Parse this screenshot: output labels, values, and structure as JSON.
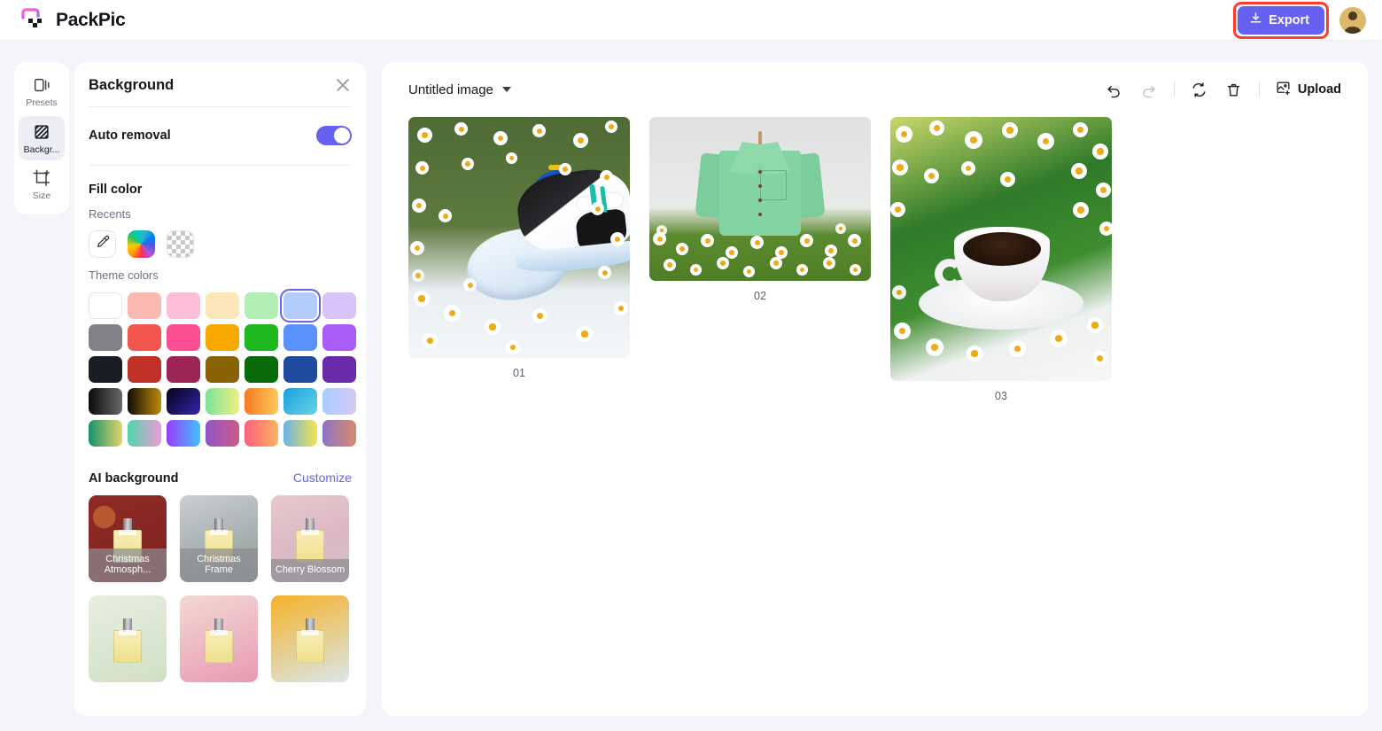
{
  "app": {
    "name": "PackPic",
    "logo_icon": "packpic-logo-icon"
  },
  "topbar": {
    "export_label": "Export",
    "export_icon": "download-icon",
    "export_color": "#6761f2",
    "highlight_color": "#ff3b30",
    "avatar_icon": "user-avatar-icon"
  },
  "rail": {
    "items": [
      {
        "label": "Presets",
        "icon": "presets-icon",
        "active": false
      },
      {
        "label": "Backgr...",
        "icon": "background-icon",
        "active": true
      },
      {
        "label": "Size",
        "icon": "size-crop-icon",
        "active": false
      }
    ]
  },
  "panel": {
    "title": "Background",
    "close_icon": "close-icon",
    "auto_removal": {
      "label": "Auto removal",
      "enabled": true,
      "accent": "#6761f2"
    },
    "fill_color": {
      "title": "Fill color",
      "recents_label": "Recents",
      "recents": [
        {
          "name": "eyedropper-swatch",
          "icon": "eyedropper-icon",
          "type": "eyedropper"
        },
        {
          "name": "rainbow-picker-swatch",
          "type": "rainbow"
        },
        {
          "name": "transparent-swatch",
          "type": "transparent"
        }
      ],
      "theme_label": "Theme colors",
      "selected_index": 5,
      "theme_colors": [
        {
          "color": "#ffffff",
          "bordered": true
        },
        {
          "color": "#fcb9b2"
        },
        {
          "color": "#fcbdd6"
        },
        {
          "color": "#fbe6b9"
        },
        {
          "color": "#b3eeb4"
        },
        {
          "color": "#b4ccfb"
        },
        {
          "color": "#d9c4fa"
        },
        {
          "color": "#808287"
        },
        {
          "color": "#f0564e"
        },
        {
          "color": "#fb4d92"
        },
        {
          "color": "#f9a800"
        },
        {
          "color": "#1eb81e"
        },
        {
          "color": "#5b91fb"
        },
        {
          "color": "#a95cf6"
        },
        {
          "color": "#1b1d24"
        },
        {
          "color": "#bf3029"
        },
        {
          "color": "#9c2457"
        },
        {
          "color": "#8a6206"
        },
        {
          "color": "#0a6b0a"
        },
        {
          "color": "#1f4a9e"
        },
        {
          "color": "#6a2aa9"
        },
        {
          "color": "linear-gradient(90deg,#0a0a0a,#6a6a6a)"
        },
        {
          "color": "linear-gradient(90deg,#100d05,#c08a0a)"
        },
        {
          "color": "linear-gradient(135deg,#050318,#3525ad)"
        },
        {
          "color": "linear-gradient(90deg,#79e39a,#f0ef80)"
        },
        {
          "color": "linear-gradient(90deg,#f87a22,#fbc85a)"
        },
        {
          "color": "linear-gradient(135deg,#1a9fe0,#68d2e8)"
        },
        {
          "color": "linear-gradient(90deg,#a9cdfb,#d6c9f7)"
        },
        {
          "color": "linear-gradient(90deg,#16916e,#e3d46a)"
        },
        {
          "color": "linear-gradient(90deg,#4fd6ad,#ef9bd4)"
        },
        {
          "color": "linear-gradient(90deg,#9b3bfb,#3fc3fb)"
        },
        {
          "color": "linear-gradient(90deg,#8e56c9,#d05a86)"
        },
        {
          "color": "linear-gradient(90deg,#fb5f7f,#fbb55f)"
        },
        {
          "color": "linear-gradient(90deg,#6ab2e8,#f4e44e)"
        },
        {
          "color": "linear-gradient(90deg,#8c73c8,#d98a6b)"
        }
      ]
    },
    "ai_background": {
      "title": "AI background",
      "customize_label": "Customize",
      "customize_color": "#6761f2",
      "items": [
        {
          "caption": "Christmas Atmosph...",
          "bg": "radial-gradient(circle at 20% 25%,#b8592f 0 12%,transparent 13%), linear-gradient(160deg,#8f2a26,#7c2320)"
        },
        {
          "caption": "Christmas Frame",
          "bg": "linear-gradient(160deg,#c9ced1,#aeb6ba 45%,#8d9a8b)"
        },
        {
          "caption": "Cherry Blossom",
          "bg": "linear-gradient(160deg,#e8c9cf,#dcb9c4 50%,#cfc1c6)"
        },
        {
          "caption": "",
          "bg": "linear-gradient(160deg,#e8eee2,#cfe0c4)"
        },
        {
          "caption": "",
          "bg": "linear-gradient(160deg,#f3d9d4,#e79ab2)"
        },
        {
          "caption": "",
          "bg": "linear-gradient(160deg,#f6b12a,#d9e7ea)"
        }
      ]
    }
  },
  "canvas": {
    "document_name": "Untitled image",
    "document_chevron_icon": "chevron-down-icon",
    "toolbar": {
      "undo_icon": "undo-icon",
      "undo_enabled": true,
      "redo_icon": "redo-icon",
      "redo_enabled": false,
      "reset_icon": "refresh-icon",
      "delete_icon": "trash-icon",
      "upload_icon": "image-upload-icon",
      "upload_label": "Upload"
    },
    "images": [
      {
        "label": "01",
        "alt": "sneakers-in-daisy-field"
      },
      {
        "label": "02",
        "alt": "green-shirt-on-hanger-in-daisy-field"
      },
      {
        "label": "03",
        "alt": "coffee-cup-in-daisy-field"
      }
    ]
  }
}
